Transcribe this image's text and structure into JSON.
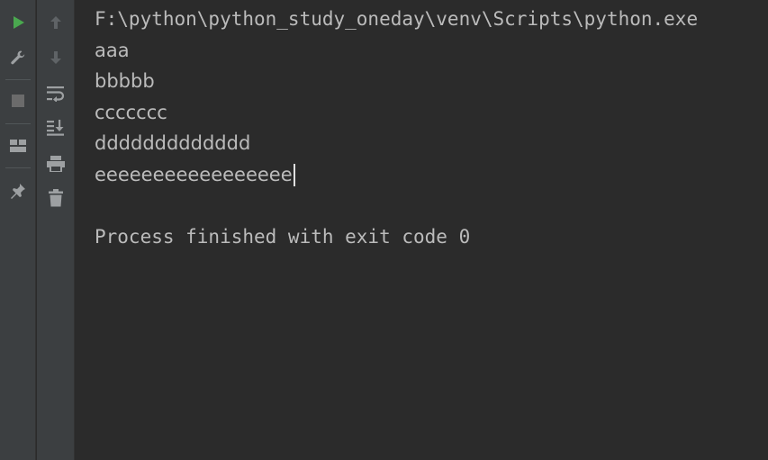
{
  "console": {
    "command_line": "F:\\python\\python_study_oneday\\venv\\Scripts\\python.exe",
    "output_lines": [
      "aaa",
      "bbbbb",
      "ccccccc",
      "ddddddddddddd",
      "eeeeeeeeeeeeeeeee"
    ],
    "exit_message": "Process finished with exit code 0"
  },
  "toolbar": {
    "left": [
      {
        "icon": "run-icon",
        "color": "#4aa84f"
      },
      {
        "icon": "wrench-icon",
        "color": "#9da0a2"
      },
      {
        "icon": "stop-icon",
        "color": "#6b6b6b"
      },
      {
        "icon": "layout-icon",
        "color": "#9da0a2"
      },
      {
        "icon": "pin-icon",
        "color": "#9da0a2"
      }
    ],
    "right": [
      {
        "icon": "arrow-up-icon",
        "color": "#5f6366"
      },
      {
        "icon": "arrow-down-icon",
        "color": "#5f6366"
      },
      {
        "icon": "soft-wrap-icon",
        "color": "#9da0a2"
      },
      {
        "icon": "scroll-to-end-icon",
        "color": "#9da0a2"
      },
      {
        "icon": "print-icon",
        "color": "#9da0a2"
      },
      {
        "icon": "trash-icon",
        "color": "#9da0a2"
      }
    ]
  },
  "colors": {
    "background": "#2b2b2b",
    "toolbar": "#3c3f41",
    "text": "#bbbbbb",
    "accent": "#4a88c7"
  }
}
